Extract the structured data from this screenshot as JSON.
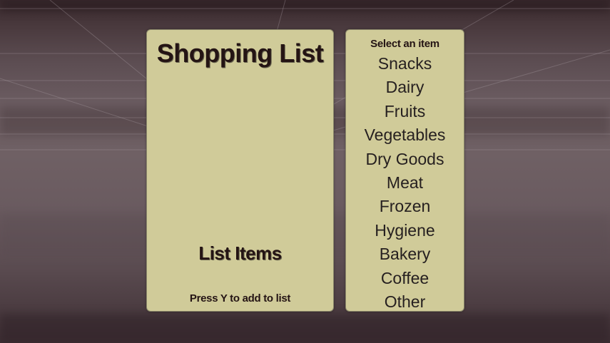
{
  "shopping_panel": {
    "title": "Shopping List",
    "list_items_label": "List Items",
    "hint": "Press Y to add to list"
  },
  "category_panel": {
    "header": "Select an item",
    "items": [
      "Snacks",
      "Dairy",
      "Fruits",
      "Vegetables",
      "Dry Goods",
      "Meat",
      "Frozen",
      "Hygiene",
      "Bakery",
      "Coffee",
      "Other"
    ]
  },
  "colors": {
    "panel_background": "#d0cb99",
    "text": "#241414",
    "scene_background": "#6a5b60"
  }
}
